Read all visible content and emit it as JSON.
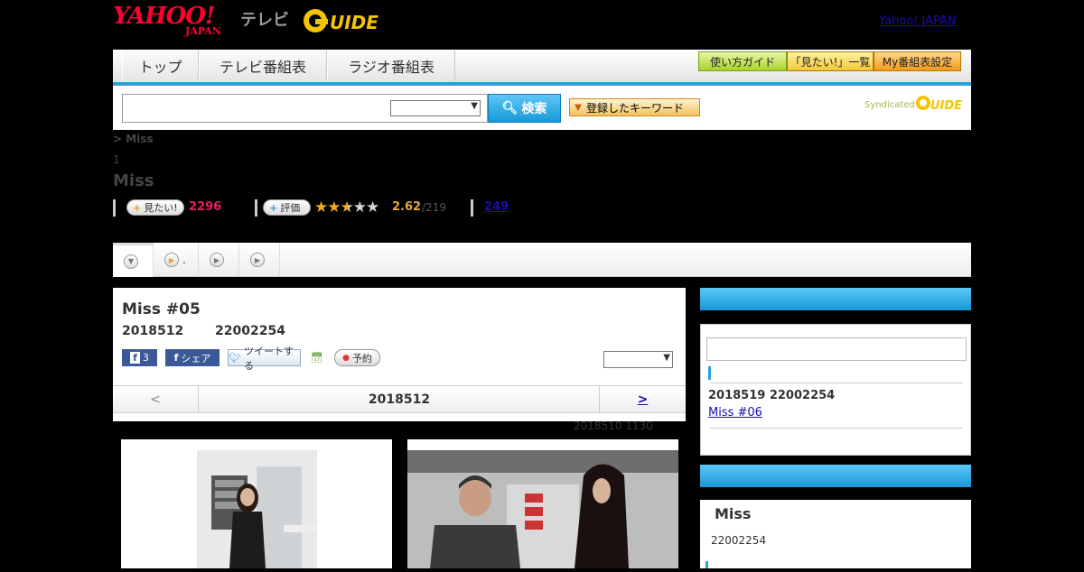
{
  "header": {
    "logo_yahoo": "YAHOO!",
    "logo_japan": "JAPAN",
    "logo_tv": "テレビ",
    "logo_gguide": "G-GUIDE",
    "yahoo_japan_link": "Yahoo! JAPAN"
  },
  "nav": {
    "tabs": [
      "トップ",
      "テレビ番組表",
      "ラジオ番組表"
    ],
    "right_buttons": [
      "使い方ガイド",
      "「見たい!」一覧",
      "My番組表設定"
    ]
  },
  "search": {
    "input_value": "",
    "select_value": "",
    "button_label": "検索",
    "keyword_button_label": "登録したキーワード",
    "syndicated_label": "Syndicated"
  },
  "program": {
    "breadcrumb": "> Miss",
    "number_label": "1",
    "title": "Miss",
    "want_label": "見たい!",
    "want_count": "2296",
    "rate_label": "評価",
    "rating_value": 2.62,
    "rating_text": "2.62",
    "rating_of": "/219",
    "review_count": "249"
  },
  "tabstrip": {
    "tab2_label": "."
  },
  "episode": {
    "title": "Miss #05",
    "date": "2018512",
    "time": "22002254",
    "fb_count": "3",
    "fb_share_label": "シェア",
    "tweet_label": "ツイートする",
    "reserve_label": "予約",
    "prev_label": "<",
    "nav_date": "2018512",
    "next_label": ">",
    "updated": "2018510  1130"
  },
  "sidebar": {
    "next_date": "2018519  22002254",
    "next_episode_link": "Miss #06 ",
    "box2_title": "Miss",
    "box2_time": "22002254"
  },
  "colors": {
    "accent_blue": "#2a9fd8",
    "want_pink": "#e0245e",
    "rating_gold": "#e6a93a",
    "link_blue": "#1a0dab"
  }
}
